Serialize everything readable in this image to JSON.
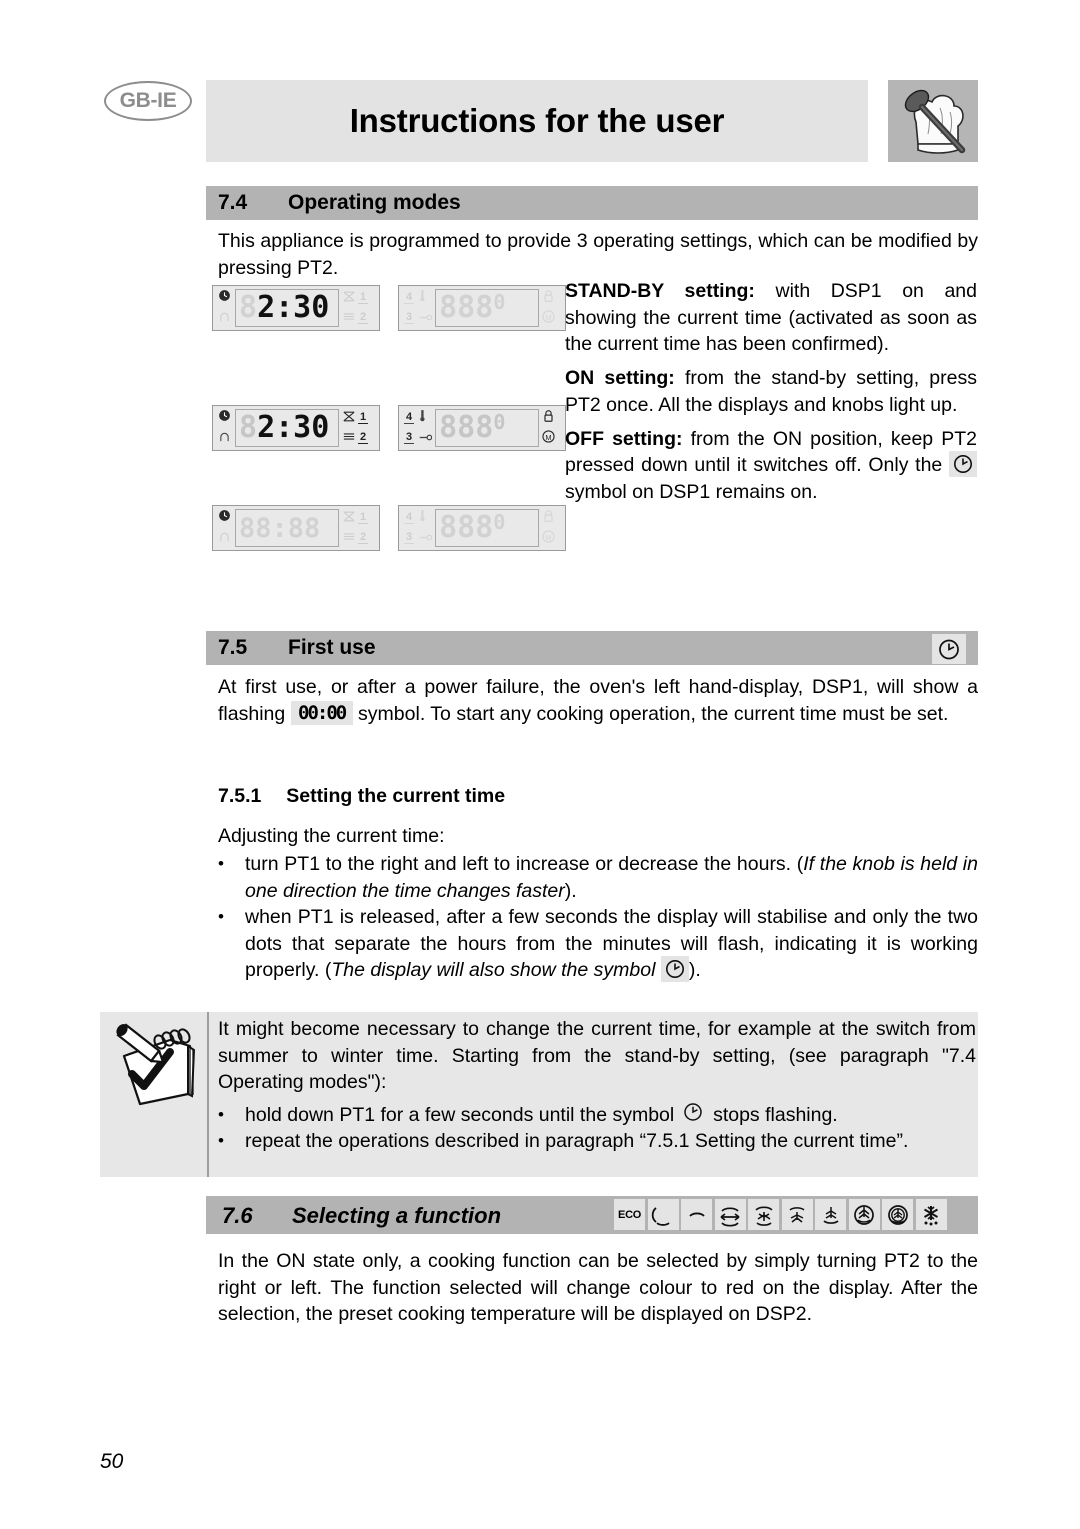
{
  "header": {
    "locale_badge": "GB-IE",
    "title": "Instructions for the user",
    "chef_icon_name": "chef-hat-spoon-icon"
  },
  "sections": {
    "operating_modes": {
      "number": "7.4",
      "title": "Operating modes",
      "intro": "This appliance is programmed to provide 3 operating settings, which can be modified by pressing PT2.",
      "modes": [
        {
          "label": "STAND-BY setting:",
          "text": " with DSP1 on and showing the current time (activated as soon as the current time has been confirmed)."
        },
        {
          "label": "ON setting:",
          "text": " from the stand-by setting, press PT2 once. All the displays and knobs light up."
        },
        {
          "label": "OFF setting:",
          "text_before": " from the ON position, keep PT2 pressed down until it switches off. Only the ",
          "text_after": " symbol on DSP1 remains on."
        }
      ],
      "displays": [
        {
          "state": "stand-by",
          "dsp1": {
            "value": "2:30",
            "leading": "8",
            "lit": true,
            "icons_left": [
              "clock-icon",
              "bell-icon"
            ],
            "icons_right": [
              "fan-icon",
              "1",
              "grill-icon",
              "2"
            ]
          },
          "dsp2": {
            "value": "888",
            "trailing": "0",
            "lit": false,
            "icons_left": [
              "4",
              "3",
              "thermometer-icon",
              "probe-icon"
            ],
            "icons_right": [
              "lock-icon",
              "M"
            ]
          }
        },
        {
          "state": "on",
          "dsp1": {
            "value": "2:30",
            "leading": "8",
            "lit": true,
            "icons_left": [
              "clock-icon",
              "bell-icon"
            ],
            "icons_right": [
              "fan-icon",
              "1",
              "grill-icon",
              "2"
            ]
          },
          "dsp2": {
            "value": "888",
            "trailing": "0",
            "lit": true,
            "icons_left": [
              "4",
              "3",
              "thermometer-icon",
              "probe-icon"
            ],
            "icons_right": [
              "lock-icon",
              "M"
            ]
          }
        },
        {
          "state": "off",
          "dsp1": {
            "value": "88:88",
            "leading": "",
            "lit": false,
            "icons_left": [
              "clock-icon",
              "bell-icon"
            ],
            "icons_right": [
              "fan-icon",
              "1",
              "grill-icon",
              "2"
            ]
          },
          "dsp2": {
            "value": "888",
            "trailing": "0",
            "lit": false,
            "icons_left": [
              "4",
              "3",
              "thermometer-icon",
              "probe-icon"
            ],
            "icons_right": [
              "lock-icon",
              "M"
            ]
          }
        }
      ]
    },
    "first_use": {
      "number": "7.5",
      "title": "First use",
      "badge_icon": "clock-icon",
      "para_part1": "At first use, or after a power failure, the oven's left hand-display, DSP1, will show a flashing ",
      "inline_symbol": "00:00",
      "para_part2": " symbol. To start any cooking operation, the current time must be set.",
      "sub": {
        "number": "7.5.1",
        "title": "Setting the current time",
        "lead": "Adjusting the current time:",
        "bullets": [
          {
            "plain": "turn PT1 to the right and left to increase or decrease the hours. (",
            "italic": "If the knob is held in one direction the time changes faster",
            "tail": ")."
          },
          {
            "plain": "when PT1 is released, after a few seconds the display will stabilise and only the two dots that separate the hours from the minutes will flash, indicating it is working properly. (",
            "italic": "The display will also show the symbol",
            "tail": ")."
          }
        ]
      }
    },
    "note": {
      "icon": "notepad-pencil-check-icon",
      "text": "It might become necessary to change the current time, for example at the switch from summer to winter time. Starting from the stand-by setting, (see paragraph \"7.4 Operating modes\"):",
      "bullets": [
        {
          "before": "hold down PT1 for a few seconds until the symbol ",
          "after": " stops flashing."
        },
        {
          "before": "repeat the operations described in paragraph “7.5.1 Setting the current time”.",
          "after": ""
        }
      ]
    },
    "selecting_function": {
      "number": "7.6",
      "title": "Selecting a function",
      "icons": [
        "eco-label",
        "lower-heat-icon",
        "upper-heat-icon",
        "upper-lower-heat-icon",
        "fan-lower-heat-icon",
        "fan-assisted-icon",
        "fan-grill-lower-icon",
        "circular-fan-icon",
        "circular-fan-grill-icon",
        "defrost-icon"
      ],
      "eco_label": "ECO",
      "body": "In the ON state only, a cooking function can be selected by simply turning PT2 to the right or left. The function selected will change colour to red on the display. After the selection, the preset cooking temperature will be displayed on DSP2."
    }
  },
  "footer": {
    "page_number": "50"
  },
  "colors": {
    "section_band": "#b3b3b3",
    "header_band": "#e3e3e3",
    "note_bg": "#e7e7e7",
    "panel_bg": "#e9e9e9",
    "lcd_off": "#d2d2d2",
    "lcd_on": "#111111"
  }
}
